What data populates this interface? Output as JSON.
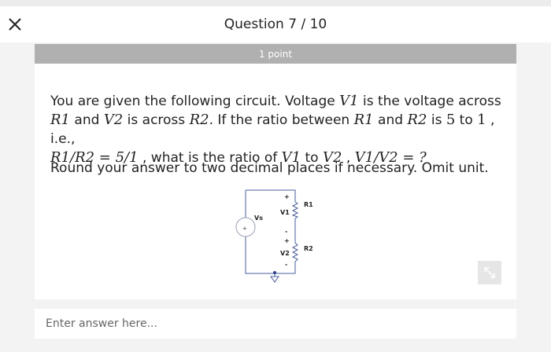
{
  "header": {
    "title": "Question 7 / 10",
    "close_icon": "close-icon"
  },
  "points_label": "1 point",
  "question": {
    "p1_a": "You are given the following circuit. Voltage ",
    "v1": "V1",
    "p1_b": " is the voltage across",
    "r1": "R1",
    "p1_c": " and ",
    "v2": "V2",
    "p1_d": " is across ",
    "r2": "R2",
    "p1_e": ". If the ratio between ",
    "r1b": "R1",
    "p1_f": " and ",
    "r2b": "R2",
    "p1_g": " is ",
    "five": "5",
    "p1_h": " to ",
    "one": "1",
    "p1_i": " , i.e.,",
    "eq1": "R1/R2 = 5/1",
    "p1_j": " , what is the ratio of ",
    "v1b": "V1",
    "p1_k": " to ",
    "v2b": "V2",
    "p1_l": " , ",
    "eq2": "V1/V2 = ?",
    "instruction": "Round your answer to two decimal places if necessary. Omit unit."
  },
  "circuit": {
    "labels": {
      "vs": "Vs",
      "v1": "V1",
      "v2": "V2",
      "r1": "R1",
      "r2": "R2",
      "plus": "+",
      "minus": "-"
    }
  },
  "answer": {
    "placeholder": "Enter answer here..."
  },
  "colors": {
    "points_bar": "#b0b0b0",
    "background": "#f3f3f3"
  }
}
